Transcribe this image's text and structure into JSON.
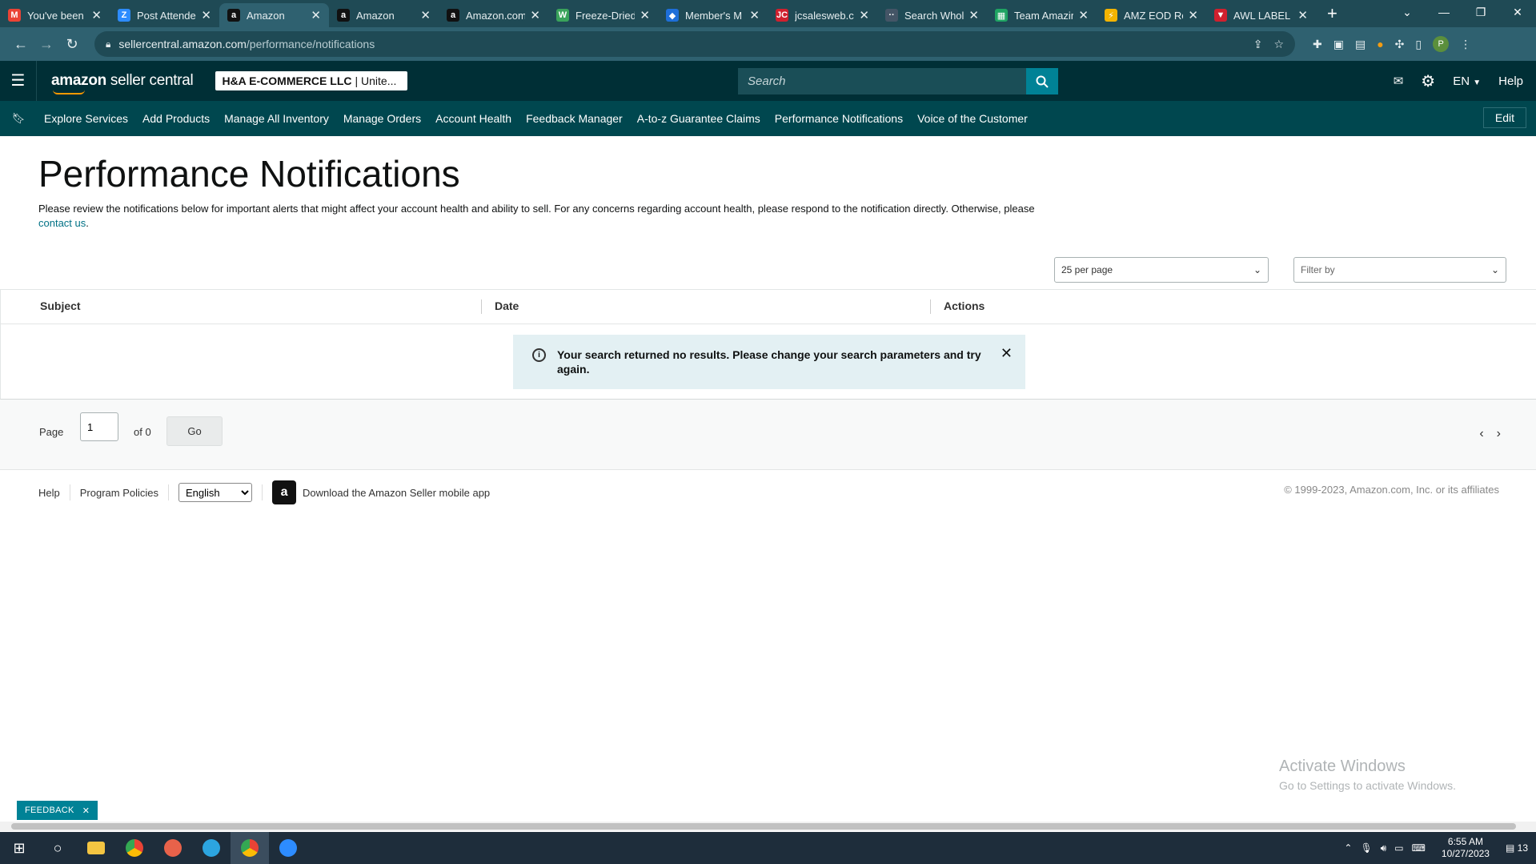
{
  "browser": {
    "tabs": [
      {
        "title": "You've been",
        "favicon_color": "#ea4335",
        "glyph": "M"
      },
      {
        "title": "Post Attende",
        "favicon_color": "#2d8cff",
        "glyph": "Z"
      },
      {
        "title": "Amazon",
        "favicon_color": "#111111",
        "glyph": "a",
        "active": true
      },
      {
        "title": "Amazon",
        "favicon_color": "#111111",
        "glyph": "a"
      },
      {
        "title": "Amazon.com",
        "favicon_color": "#111111",
        "glyph": "a"
      },
      {
        "title": "Freeze-Dried",
        "favicon_color": "#3aa35b",
        "glyph": "W"
      },
      {
        "title": "Member's M",
        "favicon_color": "#1e6fd9",
        "glyph": "◆"
      },
      {
        "title": "jcsalesweb.cc",
        "favicon_color": "#d0202e",
        "glyph": "JC"
      },
      {
        "title": "Search Whol",
        "favicon_color": "#445566",
        "glyph": "··"
      },
      {
        "title": "Team Amazir",
        "favicon_color": "#1fa463",
        "glyph": "▦"
      },
      {
        "title": "AMZ EOD Re",
        "favicon_color": "#f4b400",
        "glyph": "⚡"
      },
      {
        "title": "AWL LABEL",
        "favicon_color": "#d0202e",
        "glyph": "▼"
      }
    ],
    "close_glyph": "✕",
    "new_tab": "+",
    "url_host": "sellercentral.amazon.com",
    "url_path": "/performance/notifications",
    "profile_initial": "P"
  },
  "header": {
    "logo_bold": "amazon",
    "logo_rest": " seller central",
    "account_name": "H&A E-COMMERCE LLC",
    "account_region": "| Unite...",
    "search_placeholder": "Search",
    "language": "EN",
    "help": "Help"
  },
  "nav": {
    "items": [
      "Explore Services",
      "Add Products",
      "Manage All Inventory",
      "Manage Orders",
      "Account Health",
      "Feedback Manager",
      "A-to-z Guarantee Claims",
      "Performance Notifications",
      "Voice of the Customer"
    ],
    "edit": "Edit"
  },
  "main": {
    "title": "Performance Notifications",
    "intro_text": "Please review the notifications below for important alerts that might affect your account health and ability to sell. For any concerns regarding account health, please respond to the notification directly. Otherwise, please ",
    "intro_link": "contact us",
    "intro_end": ".",
    "per_page": "25 per page",
    "filter_placeholder": "Filter by",
    "columns": {
      "subject": "Subject",
      "date": "Date",
      "actions": "Actions"
    },
    "alert_message": "Your search returned no results. Please change your search parameters and try again.",
    "pager": {
      "page_label": "Page",
      "page_value": "1",
      "of_label": "of 0",
      "go": "Go"
    }
  },
  "footer": {
    "help": "Help",
    "policies": "Program Policies",
    "language": "English",
    "app_text": "Download the Amazon Seller mobile app",
    "copyright": "© 1999-2023, Amazon.com, Inc. or its affiliates"
  },
  "overlay": {
    "watermark_title": "Activate Windows",
    "watermark_sub": "Go to Settings to activate Windows.",
    "feedback": "FEEDBACK"
  },
  "taskbar": {
    "time": "6:55 AM",
    "date": "10/27/2023",
    "notifications": "13"
  }
}
